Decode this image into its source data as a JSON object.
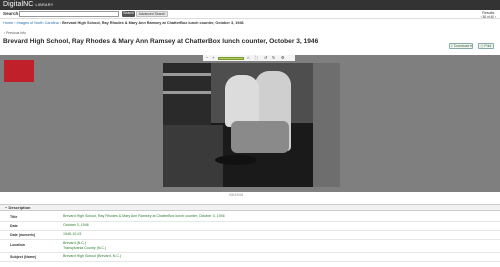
{
  "app": {
    "brand": "DigitalNC",
    "brand_sub": "LIBRARY"
  },
  "search": {
    "label": "Search:",
    "value": "",
    "search_button": "Search",
    "advanced_button": "Advanced Search",
    "results_label": "Results",
    "results_count": "38 of 40"
  },
  "breadcrumb": {
    "home": "Home",
    "collection": "Images of North Carolina",
    "current": "Brevard High School, Ray Rhodes & Mary Ann Ramsey at ChatterBox lunch counter, October 3, 1946"
  },
  "back_link": "Previous Info",
  "page_title": "Brevard High School, Ray Rhodes & Mary Ann Ramsey at ChatterBox lunch counter, October 3, 1946",
  "actions": {
    "download": "Download",
    "print": "Print"
  },
  "viewer": {
    "caption": "00043316"
  },
  "description": {
    "header": "Description",
    "rows": [
      {
        "label": "Title",
        "value": "Brevard High School, Ray Rhodes & Mary Ann Ramsey at ChatterBox lunch counter, October 3, 1946"
      },
      {
        "label": "Date",
        "value": "October 3, 1946"
      },
      {
        "label": "Date (numeric)",
        "value": "1946-10-03"
      },
      {
        "label": "Location",
        "value": "Brevard (N.C.)",
        "value2": "Transylvania County (N.C.)"
      },
      {
        "label": "Subject (Name)",
        "value": "Brevard High School (Brevard, N.C.)"
      }
    ]
  },
  "colors": {
    "topbar": "#333333",
    "link": "#2a6fa8",
    "value_green": "#2b7a2b",
    "viewer_bg": "#7f7f7f",
    "thumb_accent": "#c0202a"
  },
  "icons": {
    "back": "chevron-left-icon",
    "download": "download-icon",
    "print": "print-icon",
    "zoom_in": "zoom-in-icon",
    "zoom_out": "zoom-out-icon",
    "fullscreen": "fullscreen-icon",
    "rotate": "rotate-icon",
    "home": "home-icon",
    "collapse": "minus-icon"
  }
}
